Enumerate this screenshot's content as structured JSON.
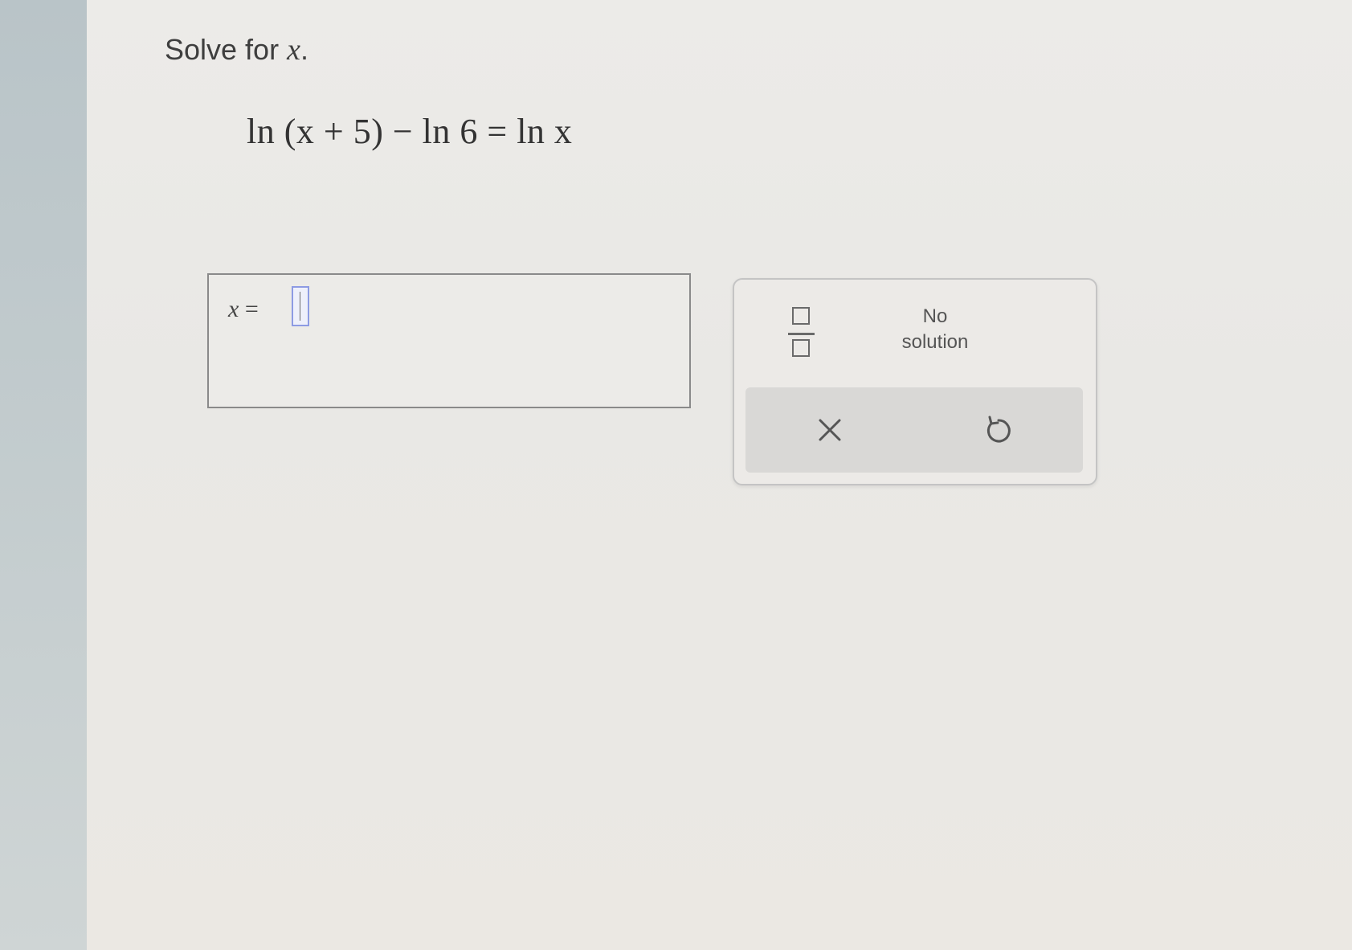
{
  "question": {
    "prompt": "Solve for ",
    "variable": "x",
    "prompt_end": ".",
    "equation": "ln (x + 5) − ln 6 = ln x"
  },
  "answer": {
    "label_var": "x",
    "label_eq": " = ",
    "value": ""
  },
  "keypad": {
    "fraction_icon": "fraction-icon",
    "no_solution_line1": "No",
    "no_solution_line2": "solution",
    "clear_icon": "close-icon",
    "undo_icon": "undo-icon"
  }
}
